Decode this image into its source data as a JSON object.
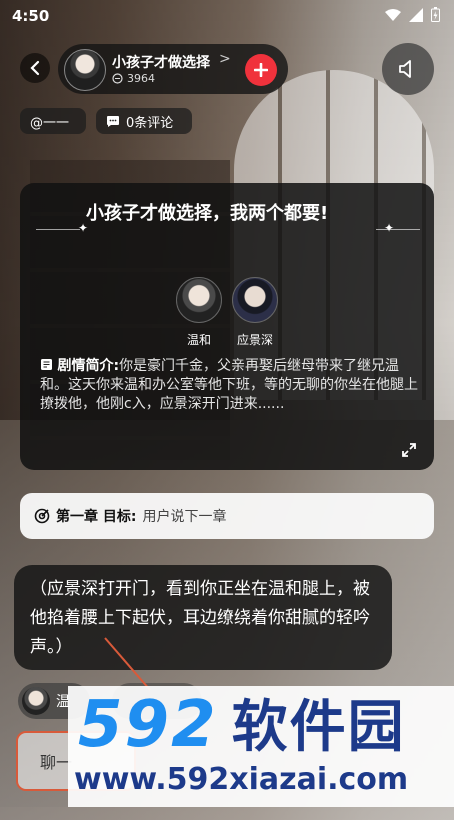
{
  "status_bar": {
    "time": "4:50"
  },
  "story": {
    "title": "小孩子才做选择",
    "chevron": ">",
    "count": "3964"
  },
  "chips": {
    "author": "@一一",
    "comments": "0条评论"
  },
  "intro": {
    "title": "小孩子才做选择，我两个都要!",
    "roles": [
      {
        "name": "温和"
      },
      {
        "name": "应景深"
      }
    ],
    "synopsis_label": "剧情简介:",
    "synopsis_text": "你是豪门千金，父亲再娶后继母带来了继兄温和。这天你来温和办公室等他下班，等的无聊的你坐在他腿上撩拨他，他刚c入，应景深开门进来......"
  },
  "goal": {
    "label": "第一章 目标:",
    "text": "用户说下一章"
  },
  "narration": "（应景深打开门，看到你正坐在温和腿上，被他掐着腰上下起伏，耳边缭绕着你甜腻的轻吟声。）",
  "reply_chip": {
    "label": "温"
  },
  "chat_input": {
    "placeholder": "聊一"
  },
  "watermark": {
    "logo_num": "592",
    "logo_cn": "软件园",
    "url": "www.592xiazai.com"
  },
  "colors": {
    "accent_red": "#f0323c",
    "watermark_blue": "#1f8ef0",
    "watermark_navy": "#1d3a8a"
  }
}
